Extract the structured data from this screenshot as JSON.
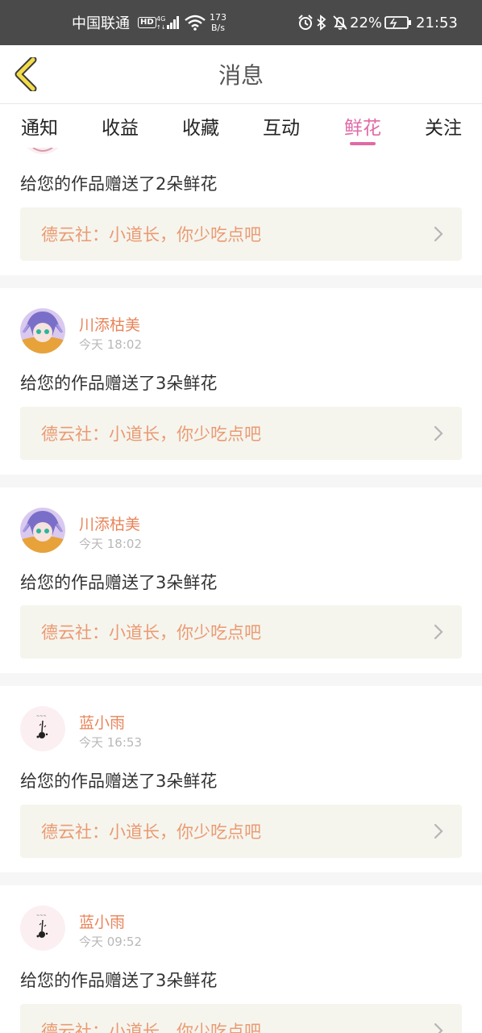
{
  "status_bar": {
    "carrier": "中国联通",
    "hd": "HD",
    "network": "4G",
    "speed_value": "173",
    "speed_unit": "B/s",
    "battery": "22%",
    "time": "21:53"
  },
  "header": {
    "title": "消息"
  },
  "tabs": [
    {
      "label": "通知",
      "active": false
    },
    {
      "label": "收益",
      "active": false
    },
    {
      "label": "收藏",
      "active": false
    },
    {
      "label": "互动",
      "active": false
    },
    {
      "label": "鲜花",
      "active": true
    },
    {
      "label": "关注",
      "active": false
    }
  ],
  "colors": {
    "accent": "#e06aa6",
    "username": "#e8845a",
    "work_title": "#eb9a72",
    "work_bg": "#f5f5ee"
  },
  "messages": [
    {
      "user": "",
      "time": "",
      "text": "给您的作品赠送了2朵鲜花",
      "work": "德云社：小道长，你少吃点吧",
      "avatar": "partial-avatar"
    },
    {
      "user": "川添枯美",
      "time": "今天 18:02",
      "text": "给您的作品赠送了3朵鲜花",
      "work": "德云社：小道长，你少吃点吧",
      "avatar": "anime-avatar"
    },
    {
      "user": "川添枯美",
      "time": "今天 18:02",
      "text": "给您的作品赠送了3朵鲜花",
      "work": "德云社：小道长，你少吃点吧",
      "avatar": "anime-avatar"
    },
    {
      "user": "蓝小雨",
      "time": "今天 16:53",
      "text": "给您的作品赠送了3朵鲜花",
      "work": "德云社：小道长，你少吃点吧",
      "avatar": "sketch-avatar"
    },
    {
      "user": "蓝小雨",
      "time": "今天 09:52",
      "text": "给您的作品赠送了3朵鲜花",
      "work": "德云社：小道长，你少吃点吧",
      "avatar": "sketch-avatar"
    }
  ]
}
